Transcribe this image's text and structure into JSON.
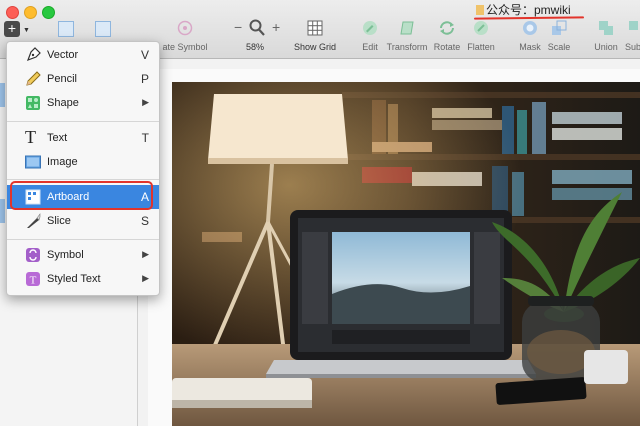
{
  "toolbar": {
    "zoom_value": "58%",
    "buttons": [
      {
        "label": "Create Symbol",
        "visible_label": "ate Symbol"
      },
      {
        "label": "Show Grid"
      },
      {
        "label": "Edit"
      },
      {
        "label": "Transform"
      },
      {
        "label": "Rotate"
      },
      {
        "label": "Flatten"
      },
      {
        "label": "Mask"
      },
      {
        "label": "Scale"
      },
      {
        "label": "Union"
      },
      {
        "label": "Subtract",
        "visible_label": "Sub"
      }
    ],
    "zoom_minus": "−",
    "zoom_plus": "+"
  },
  "watermark": {
    "text": "公众号：pmwiki"
  },
  "insert_menu": {
    "items": [
      {
        "label": "Vector",
        "shortcut": "V"
      },
      {
        "label": "Pencil",
        "shortcut": "P"
      },
      {
        "label": "Shape",
        "submenu": "▶"
      },
      {
        "label": "Text",
        "shortcut": "T"
      },
      {
        "label": "Image"
      },
      {
        "label": "Artboard",
        "shortcut": "A"
      },
      {
        "label": "Slice",
        "shortcut": "S"
      },
      {
        "label": "Symbol",
        "submenu": "▶"
      },
      {
        "label": "Styled Text",
        "submenu": "▶"
      }
    ],
    "selected": "Artboard"
  },
  "colors": {
    "selection": "#3a86e0",
    "annotation_red": "#e2342b",
    "disabled_icon": "#9bd0b0"
  }
}
